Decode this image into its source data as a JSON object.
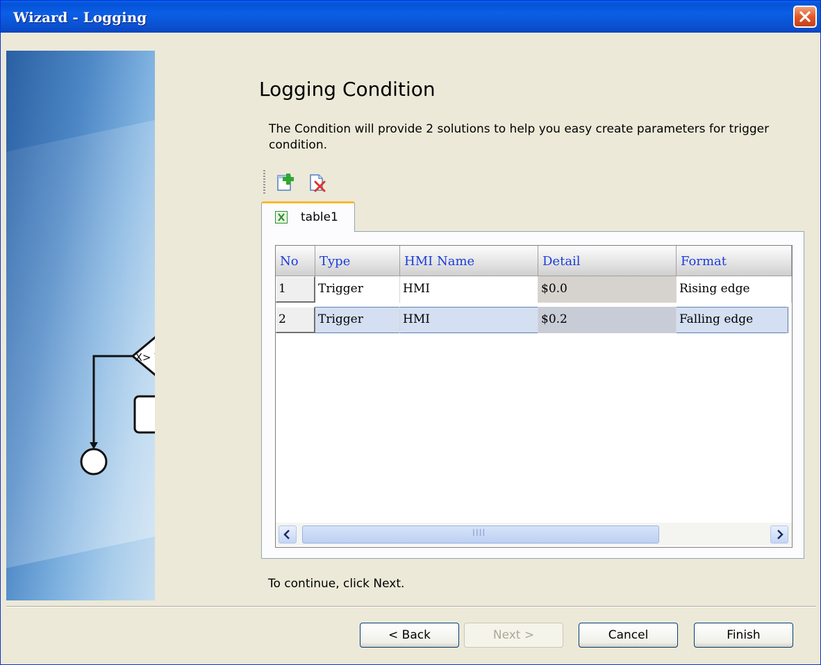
{
  "window": {
    "title": "Wizard - Logging",
    "close_icon": "close-icon"
  },
  "sidebar": {
    "decision_label": "X> Y"
  },
  "page": {
    "heading": "Logging Condition",
    "description": "The Condition will provide 2 solutions to  help you easy create parameters for trigger condition.",
    "continue_hint": "To continue, click Next."
  },
  "toolbar": {
    "add_icon": "add-table-icon",
    "delete_icon": "delete-table-icon"
  },
  "tabs": [
    {
      "label": "table1",
      "icon": "excel-table-icon",
      "active": true
    }
  ],
  "grid": {
    "columns": [
      "No",
      "Type",
      "HMI Name",
      "Detail",
      "Format"
    ],
    "rows": [
      {
        "no": "1",
        "type": "Trigger",
        "hmi_name": "HMI",
        "detail": "$0.0",
        "format": "Rising edge"
      },
      {
        "no": "2",
        "type": "Trigger",
        "hmi_name": "HMI",
        "detail": "$0.2",
        "format": "Falling edge",
        "selected": true
      }
    ],
    "scroll_thumb_grip": "IIII"
  },
  "buttons": {
    "back": "< Back",
    "next": "Next >",
    "cancel": "Cancel",
    "finish": "Finish"
  },
  "colors": {
    "titlebar": "#0a5ae0",
    "header_text": "#1a3cdc",
    "selected_row": "#d4dff2",
    "tab_accent": "#f9b830"
  }
}
